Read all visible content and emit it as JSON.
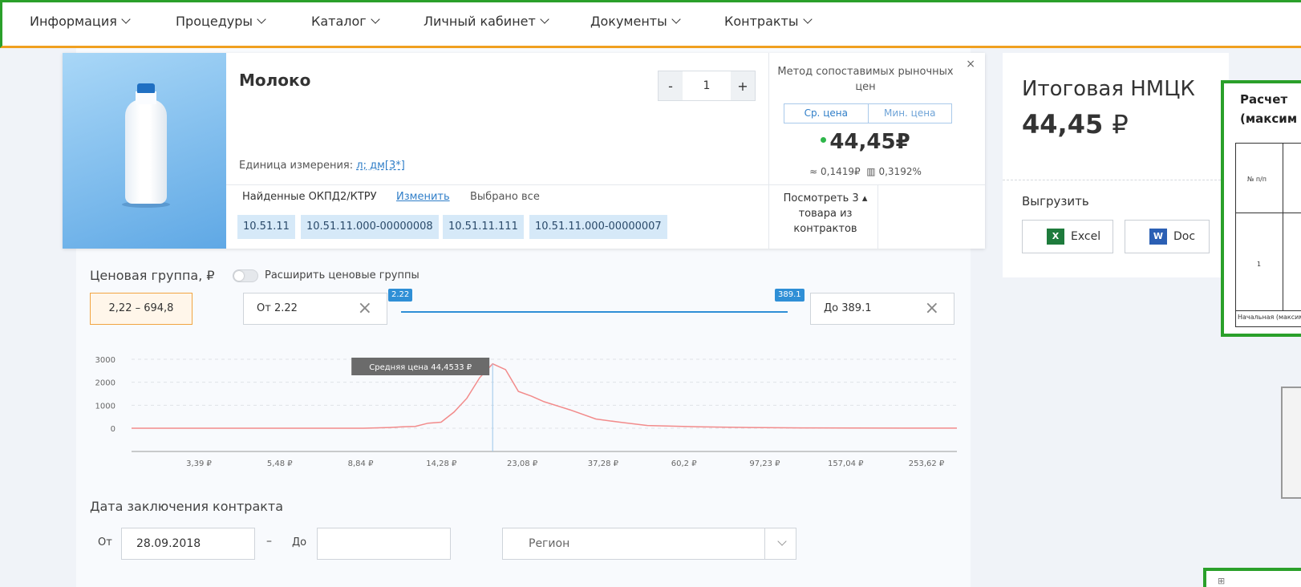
{
  "nav": {
    "items": [
      {
        "label": "Информация"
      },
      {
        "label": "Процедуры"
      },
      {
        "label": "Каталог"
      },
      {
        "label": "Личный кабинет"
      },
      {
        "label": "Документы"
      },
      {
        "label": "Контракты"
      }
    ]
  },
  "product": {
    "title": "Молоко",
    "quantity": "1",
    "qty_minus": "-",
    "qty_plus": "+",
    "unit_label": "Единица измерения:",
    "unit_value": "л; дм[3*]",
    "okpd_label": "Найденные ОКПД2/КТРУ",
    "okpd_change": "Изменить",
    "okpd_selected": "Выбрано все",
    "codes": [
      "10.51.11",
      "10.51.11.000-00000008",
      "10.51.11.111",
      "10.51.11.000-00000007"
    ]
  },
  "method": {
    "title": "Метод сопоставимых рыночных цен",
    "close": "×",
    "tab_avg": "Ср. цена",
    "tab_min": "Мин. цена",
    "price": "44,45₽",
    "stat1": "0,1419₽",
    "stat2": "0,3192%",
    "view_contracts": "Посмотреть 3 ▴ товара из контрактов"
  },
  "summary": {
    "title": "Итоговая НМЦК",
    "price": "44,45",
    "currency": "₽",
    "export_label": "Выгрузить",
    "excel": "Excel",
    "doc": "Doc",
    "excel_icon": "excel-icon",
    "doc_icon": "word-icon"
  },
  "document": {
    "title_line1": "Расчет",
    "title_line2": "(максим",
    "col_num": "№ п/п",
    "row1": "1",
    "footer": "Начальная (максим"
  },
  "price_group": {
    "label": "Ценовая группа, ₽",
    "toggle_label": "Расширить ценовые группы",
    "range": "2,22 – 694,8",
    "from_label": "От",
    "from_value": "2.22",
    "to_label": "До",
    "to_value": "389.1",
    "slider_min_flag": "2.22",
    "slider_max_flag": "389.1"
  },
  "chart_data": {
    "type": "area",
    "y_ticks": [
      "3000",
      "2000",
      "1000",
      "0"
    ],
    "ylim": [
      0,
      3000
    ],
    "x_tick_labels": [
      "3,39 ₽",
      "5,48 ₽",
      "8,84 ₽",
      "14,28 ₽",
      "23,08 ₽",
      "37,28 ₽",
      "60,2 ₽",
      "97,23 ₽",
      "157,04 ₽",
      "253,62 ₽"
    ],
    "x_index": [
      0,
      2,
      4,
      6,
      8,
      10,
      12,
      14,
      16,
      18,
      20,
      21,
      22,
      23,
      24,
      25,
      26,
      27,
      28,
      29,
      30,
      31,
      32,
      34,
      36,
      38,
      40,
      44,
      48,
      52,
      56,
      60,
      64
    ],
    "values": [
      0,
      0,
      0,
      0,
      0,
      0,
      0,
      0,
      0,
      0,
      30,
      60,
      80,
      220,
      260,
      700,
      1300,
      2200,
      2800,
      2550,
      1600,
      1400,
      1150,
      800,
      400,
      250,
      120,
      60,
      30,
      15,
      8,
      5,
      3
    ],
    "tooltip": "Средняя цена 44,4533 ₽",
    "line_color": "#f28b8b",
    "grid": true
  },
  "date": {
    "label": "Дата заключения контракта",
    "from_label": "От",
    "from_value": "28.09.2018",
    "dash": "–",
    "to_label": "До",
    "to_value": "",
    "region_placeholder": "Регион"
  }
}
